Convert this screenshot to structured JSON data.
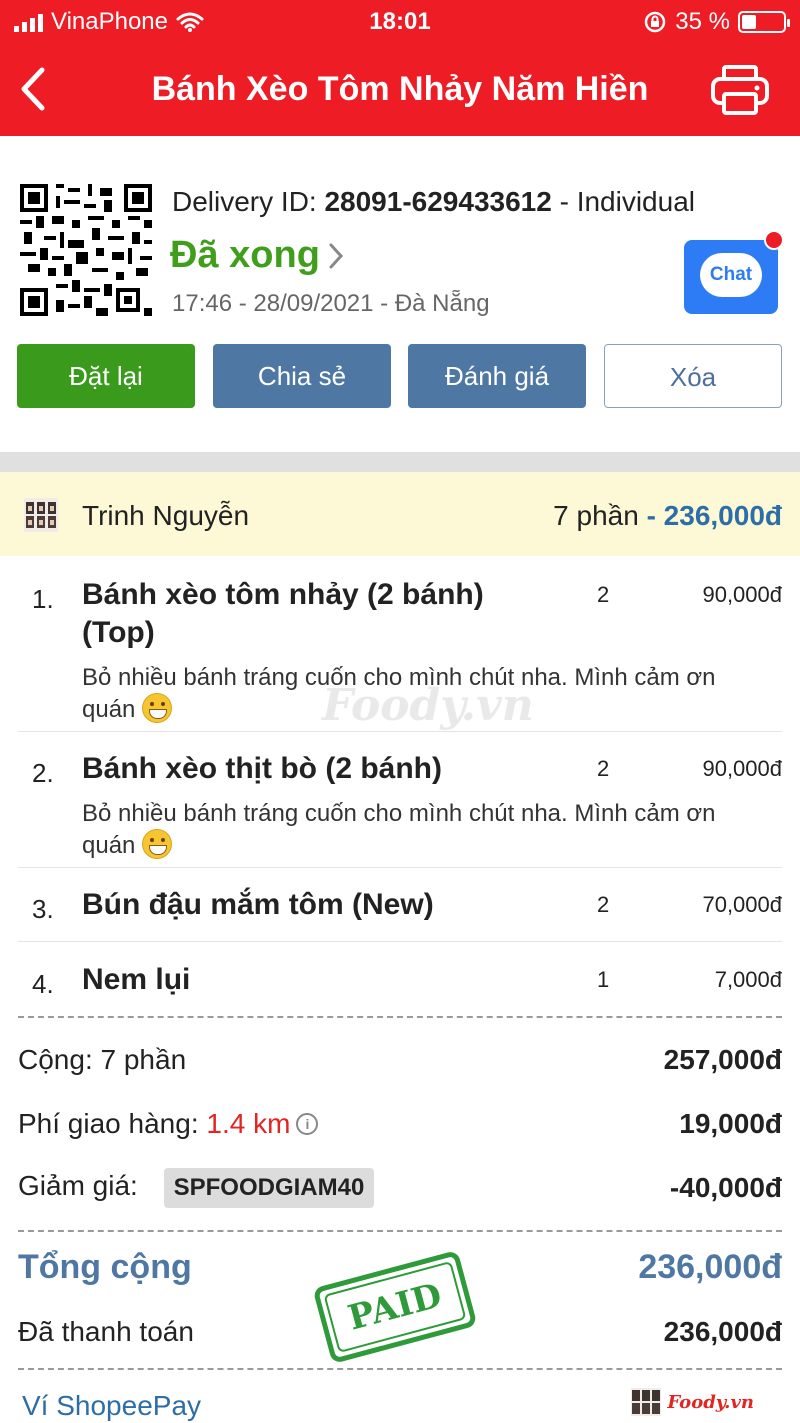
{
  "status_bar": {
    "carrier": "VinaPhone",
    "time": "18:01",
    "battery_text": "35 %",
    "battery_level": 0.35
  },
  "nav": {
    "title": "Bánh Xèo Tôm Nhảy Năm Hiền",
    "back_icon": "chevron-left-icon",
    "print_icon": "printer-icon"
  },
  "order": {
    "delivery_label": "Delivery ID: ",
    "delivery_id": "28091-629433612",
    "delivery_type": " - Individual",
    "status": "Đã xong",
    "datetime_location": "17:46 - 28/09/2021 - Đà Nẵng",
    "chat_label": "Chat"
  },
  "actions": {
    "reorder": "Đặt lại",
    "share": "Chia sẻ",
    "rate": "Đánh giá",
    "delete": "Xóa"
  },
  "customer": {
    "name": "Trinh Nguyễn",
    "portions": "7 phần",
    "total": " - 236,000đ"
  },
  "items": [
    {
      "num": "1.",
      "name": "Bánh xèo tôm nhảy (2 bánh) (Top)",
      "qty": "2",
      "price": "90,000đ",
      "note": "Bỏ nhiều bánh tráng cuốn cho mình chút nha. Mình cảm ơn quán"
    },
    {
      "num": "2.",
      "name": "Bánh xèo thịt bò (2 bánh)",
      "qty": "2",
      "price": "90,000đ",
      "note": "Bỏ nhiều bánh tráng cuốn cho mình chút nha. Mình cảm ơn quán"
    },
    {
      "num": "3.",
      "name": "Bún đậu mắm tôm (New)",
      "qty": "2",
      "price": "70,000đ"
    },
    {
      "num": "4.",
      "name": "Nem lụi",
      "qty": "1",
      "price": "7,000đ"
    }
  ],
  "summary": {
    "subtotal_label": "Cộng: 7 phần",
    "subtotal": "257,000đ",
    "shipping_label": "Phí giao hàng:",
    "distance": "1.4 km",
    "shipping": "19,000đ",
    "discount_label": "Giảm giá:",
    "voucher": "SPFOODGIAM40",
    "discount": "-40,000đ",
    "total_label": "Tổng cộng",
    "total": "236,000đ",
    "paid_label": "Đã thanh toán",
    "paid": "236,000đ",
    "stamp": "PAID",
    "payment_method": "Ví ShopeePay"
  },
  "watermark": "Foody.vn",
  "colors": {
    "brand_red": "#ee1c25",
    "success_green": "#3f9e1a",
    "action_blue": "#4f77a3",
    "price_blue": "#2d6ea6",
    "customer_bg": "#fdf9d7"
  }
}
